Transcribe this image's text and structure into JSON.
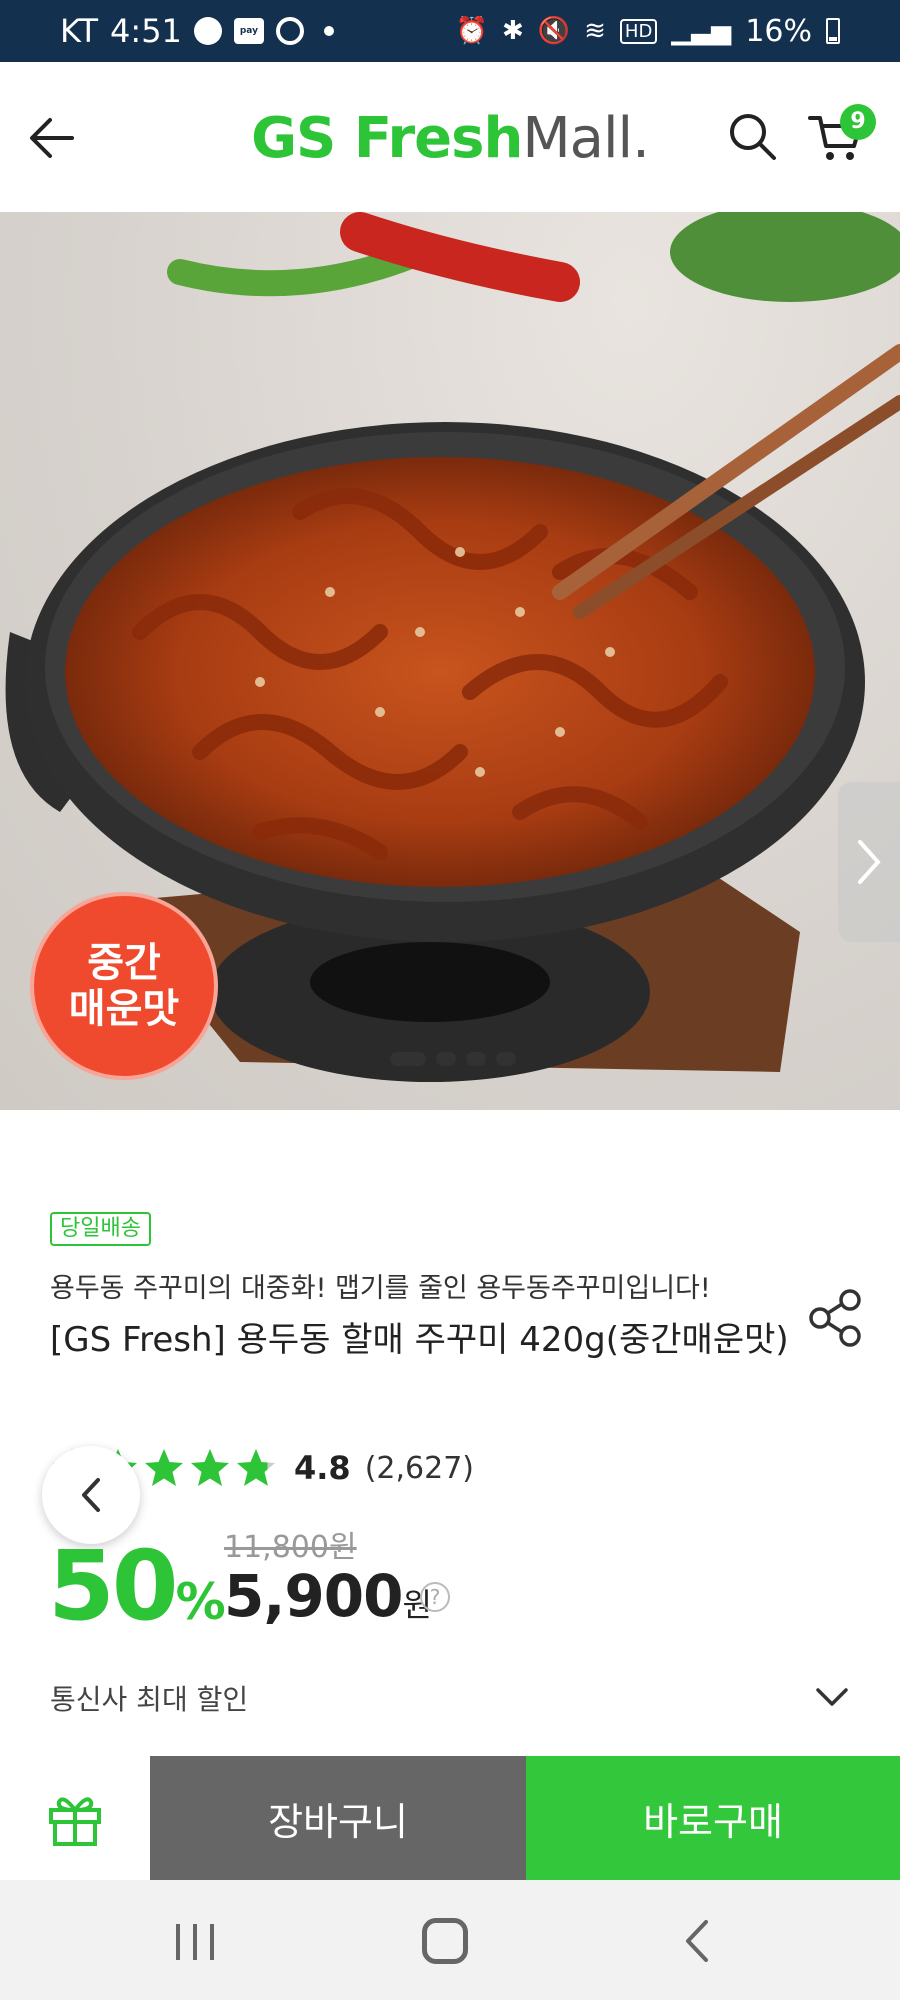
{
  "status_bar": {
    "carrier": "KT",
    "time": "4:51",
    "pay_label": "pay",
    "battery": "16%",
    "hd_label": "HD"
  },
  "header": {
    "logo_primary": "GS Fresh",
    "logo_secondary": "Mall.",
    "cart_count": "9",
    "accent_color": "#2ec438"
  },
  "product_image": {
    "spicy_badge_line1": "중간",
    "spicy_badge_line2": "매운맛",
    "slide_count": 4,
    "active_slide": 1
  },
  "product": {
    "delivery_badge": "당일배송",
    "subtitle": "용두동 주꾸미의 대중화! 맵기를 줄인 용두동주꾸미입니다!",
    "title": "[GS Fresh] 용두동 할매 주꾸미 420g(중간매운맛)",
    "rating": "4.8",
    "rating_stars": 4.8,
    "review_count": "(2,627)",
    "original_price": "11,800원",
    "discount_number": "50",
    "discount_symbol": "%",
    "price": "5,900",
    "price_unit": "원",
    "help_symbol": "?",
    "telecom_discount": "통신사 최대 할인"
  },
  "action_bar": {
    "add_to_cart": "장바구니",
    "buy_now": "바로구매"
  },
  "icons": {
    "back": "arrow-left-icon",
    "search": "search-icon",
    "cart": "cart-icon",
    "share": "share-icon",
    "gift": "gift-icon",
    "chevron_down": "chevron-down-icon",
    "carousel_next": "chevron-right-icon"
  }
}
